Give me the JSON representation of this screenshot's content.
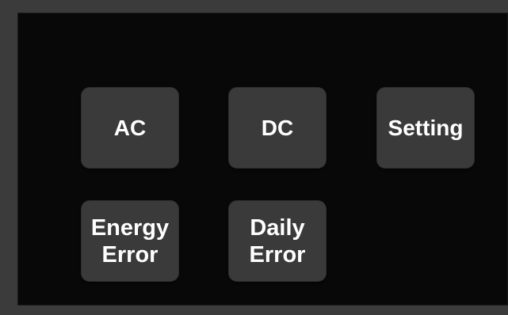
{
  "menu": {
    "buttons": [
      {
        "id": "ac",
        "label": "AC"
      },
      {
        "id": "dc",
        "label": "DC"
      },
      {
        "id": "setting",
        "label": "Setting"
      },
      {
        "id": "energy-error",
        "label": "Energy\nError"
      },
      {
        "id": "daily-error",
        "label": "Daily\nError"
      }
    ]
  },
  "colors": {
    "screen_background": "#080808",
    "bezel": "#3b3b3b",
    "button_background": "#3a3a3a",
    "button_text": "#ffffff"
  }
}
